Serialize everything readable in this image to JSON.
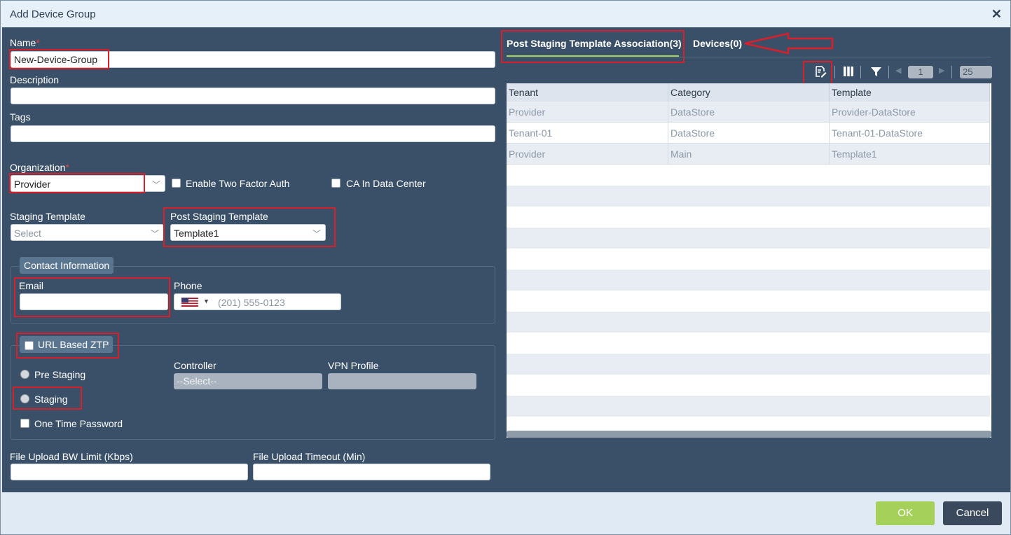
{
  "dialog": {
    "title": "Add Device Group"
  },
  "form": {
    "name_label": "Name",
    "required_mark": "*",
    "name_value": "New-Device-Group",
    "description_label": "Description",
    "tags_label": "Tags",
    "organization_label": "Organization",
    "organization_value": "Provider",
    "two_factor_label": "Enable Two Factor Auth",
    "ca_label": "CA In Data Center",
    "staging_template_label": "Staging Template",
    "staging_template_placeholder": "Select",
    "post_staging_label": "Post Staging Template",
    "post_staging_value": "Template1",
    "contact_legend": "Contact Information",
    "email_label": "Email",
    "phone_label": "Phone",
    "phone_placeholder": "(201) 555-0123",
    "url_ztp_label": "URL Based ZTP",
    "pre_staging_label": "Pre Staging",
    "staging_label": "Staging",
    "otp_label": "One Time Password",
    "controller_label": "Controller",
    "controller_placeholder": "--Select--",
    "vpn_label": "VPN Profile",
    "bw_label": "File Upload BW Limit (Kbps)",
    "timeout_label": "File Upload Timeout (Min)"
  },
  "tabs": [
    {
      "label": "Post Staging Template Association(3)"
    },
    {
      "label": "Devices(0)"
    }
  ],
  "pager": {
    "page": "1",
    "page_size": "25"
  },
  "table": {
    "columns": [
      "Tenant",
      "Category",
      "Template"
    ],
    "rows": [
      [
        "Provider",
        "DataStore",
        "Provider-DataStore"
      ],
      [
        "Tenant-01",
        "DataStore",
        "Tenant-01-DataStore"
      ],
      [
        "Provider",
        "Main",
        "Template1"
      ]
    ]
  },
  "footer": {
    "ok_label": "OK",
    "cancel_label": "Cancel"
  },
  "colors": {
    "panel": "#3a5068",
    "ok": "#a5d05a",
    "cancel": "#3a4a5c",
    "highlight": "#d9202a"
  }
}
